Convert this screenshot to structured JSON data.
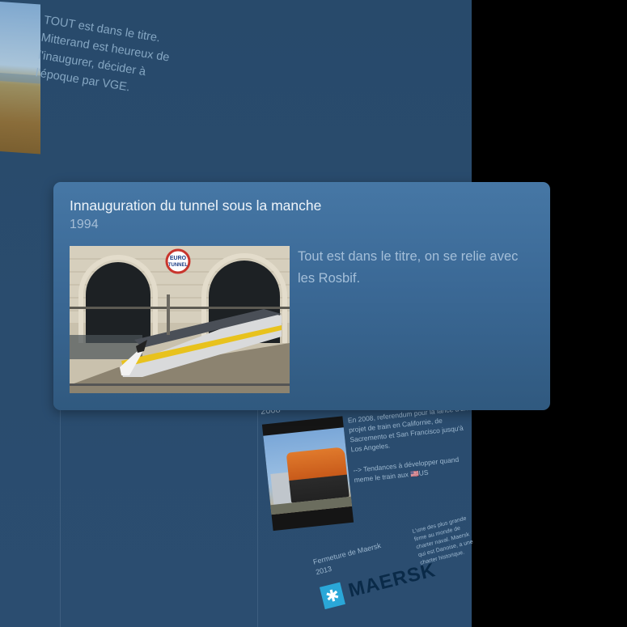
{
  "background_card": {
    "text_lines": [
      "TOUT est dans le titre.",
      "Mitterand est heureux de",
      "l'inaugurer, décider à",
      "l'époque par VGE."
    ]
  },
  "main_card": {
    "title": "Innauguration du tunnel sous la manche",
    "year": "1994",
    "description": "Tout est dans le titre, on se relie avec les Rosbif.",
    "photo": {
      "logo_top": "EURO",
      "logo_bottom": "TUNNEL"
    }
  },
  "card_2008": {
    "year": "2008",
    "body_1": "En 2008, referendum pour la lancé d'un projet de train en Californie, de Sacremento et San Francisco jusqu'à Los Angeles.",
    "body_2": "--> Tendances à développer quand meme le train aux 🇺🇸US"
  },
  "card_maersk": {
    "title": "Fermeture de Maersk",
    "year": "2013",
    "brand": "MAERSK",
    "star": "✱",
    "side_text": "L'une des plus grande firme au monde de charter naval. Maersk qui est Danoise, a une charter historique."
  },
  "colors": {
    "panel": "#2a4c6e",
    "card": "#3b6996",
    "maersk_blue": "#2aa7d8"
  }
}
